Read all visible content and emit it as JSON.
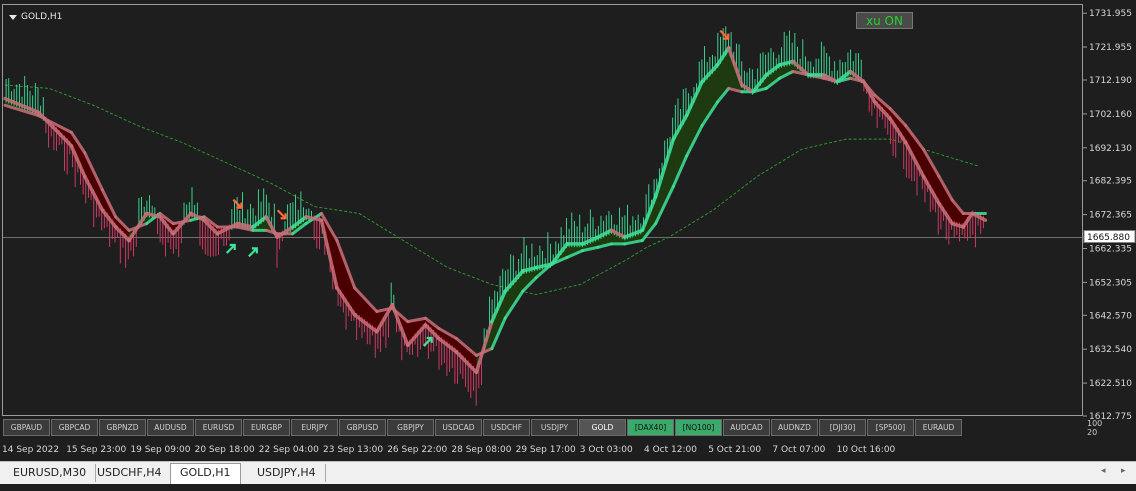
{
  "chart_data": {
    "type": "line",
    "title": "GOLD,H1",
    "symbol": "GOLD",
    "timeframe": "H1",
    "ylim": [
      1612.775,
      1733.5
    ],
    "y_ticks": [
      1731.955,
      1721.955,
      1712.19,
      1702.16,
      1692.13,
      1682.395,
      1672.365,
      1662.335,
      1652.305,
      1642.57,
      1632.54,
      1622.51,
      1612.775
    ],
    "x_ticks": [
      "14 Sep 2022",
      "15 Sep 23:00",
      "19 Sep 09:00",
      "20 Sep 18:00",
      "22 Sep 04:00",
      "23 Sep 13:00",
      "26 Sep 22:00",
      "28 Sep 08:00",
      "29 Sep 17:00",
      "3 Oct 03:00",
      "4 Oct 12:00",
      "5 Oct 21:00",
      "7 Oct 07:00",
      "10 Oct 16:00"
    ],
    "current_price": "1665.880",
    "current_price_value": 1665.88,
    "grid": false,
    "series": [
      {
        "kind": "fast-band",
        "points": [
          [
            0,
            1707
          ],
          [
            1.5,
            1703
          ],
          [
            3,
            1693
          ],
          [
            3.6,
            1684
          ],
          [
            4.4,
            1674
          ],
          [
            5,
            1669
          ],
          [
            5.6,
            1665
          ],
          [
            6.4,
            1673
          ],
          [
            7,
            1672
          ],
          [
            7.6,
            1667
          ],
          [
            8.4,
            1673
          ],
          [
            9,
            1671
          ],
          [
            9.6,
            1667
          ],
          [
            10.5,
            1670
          ],
          [
            11.2,
            1669
          ],
          [
            11.8,
            1672
          ],
          [
            12.3,
            1666
          ],
          [
            13,
            1669
          ],
          [
            13.6,
            1672
          ],
          [
            14.3,
            1671
          ],
          [
            15,
            1651
          ],
          [
            15.8,
            1643
          ],
          [
            16.8,
            1638
          ],
          [
            17.5,
            1646
          ],
          [
            18.2,
            1634
          ],
          [
            19,
            1640
          ],
          [
            19.6,
            1636
          ],
          [
            20.4,
            1632
          ],
          [
            21.3,
            1626
          ],
          [
            22,
            1641
          ],
          [
            22.6,
            1650
          ],
          [
            23.4,
            1656
          ],
          [
            24,
            1657
          ],
          [
            24.7,
            1658
          ],
          [
            25.4,
            1664
          ],
          [
            26.1,
            1664
          ],
          [
            26.8,
            1666
          ],
          [
            27.4,
            1668
          ],
          [
            28,
            1666
          ],
          [
            28.8,
            1668
          ],
          [
            29.4,
            1678
          ],
          [
            30.2,
            1695
          ],
          [
            30.8,
            1702
          ],
          [
            31.5,
            1712
          ],
          [
            32.2,
            1717
          ],
          [
            32.7,
            1722
          ],
          [
            33.3,
            1711
          ],
          [
            33.8,
            1709
          ],
          [
            34.4,
            1714
          ],
          [
            35,
            1717
          ],
          [
            35.6,
            1718
          ],
          [
            36.3,
            1714
          ],
          [
            37,
            1714
          ],
          [
            37.6,
            1712
          ],
          [
            38.2,
            1715
          ],
          [
            38.8,
            1712
          ],
          [
            39.3,
            1706
          ],
          [
            40,
            1701
          ],
          [
            40.7,
            1694
          ],
          [
            41.5,
            1684
          ],
          [
            42.2,
            1676
          ],
          [
            42.8,
            1670
          ],
          [
            43.3,
            1669
          ],
          [
            43.7,
            1673
          ],
          [
            44.3,
            1671
          ]
        ]
      },
      {
        "kind": "slow-band",
        "points": [
          [
            0,
            1705
          ],
          [
            1.5,
            1702
          ],
          [
            3,
            1697
          ],
          [
            3.6,
            1691
          ],
          [
            4.4,
            1680
          ],
          [
            5,
            1672
          ],
          [
            5.6,
            1668
          ],
          [
            6.4,
            1670
          ],
          [
            7,
            1673
          ],
          [
            7.6,
            1670
          ],
          [
            8.4,
            1671
          ],
          [
            9,
            1672
          ],
          [
            9.6,
            1669
          ],
          [
            10.5,
            1669
          ],
          [
            11.2,
            1668
          ],
          [
            11.8,
            1668
          ],
          [
            12.3,
            1667
          ],
          [
            13,
            1667
          ],
          [
            13.6,
            1670
          ],
          [
            14.3,
            1673
          ],
          [
            15,
            1665
          ],
          [
            15.8,
            1651
          ],
          [
            16.8,
            1644
          ],
          [
            17.5,
            1645
          ],
          [
            18.2,
            1641
          ],
          [
            19,
            1642
          ],
          [
            19.6,
            1639
          ],
          [
            20.4,
            1636
          ],
          [
            21.3,
            1631
          ],
          [
            22,
            1633
          ],
          [
            22.6,
            1642
          ],
          [
            23.4,
            1650
          ],
          [
            24,
            1654
          ],
          [
            24.7,
            1658
          ],
          [
            25.4,
            1660
          ],
          [
            26.1,
            1662
          ],
          [
            26.8,
            1663
          ],
          [
            27.4,
            1664
          ],
          [
            28,
            1664
          ],
          [
            28.8,
            1665
          ],
          [
            29.4,
            1670
          ],
          [
            30.2,
            1681
          ],
          [
            30.8,
            1690
          ],
          [
            31.5,
            1699
          ],
          [
            32.2,
            1706
          ],
          [
            32.7,
            1710
          ],
          [
            33.3,
            1709
          ],
          [
            33.8,
            1709
          ],
          [
            34.4,
            1710
          ],
          [
            35,
            1713
          ],
          [
            35.6,
            1715
          ],
          [
            36.3,
            1714
          ],
          [
            37,
            1713
          ],
          [
            37.6,
            1712
          ],
          [
            38.2,
            1713
          ],
          [
            38.8,
            1712
          ],
          [
            39.3,
            1708
          ],
          [
            40,
            1704
          ],
          [
            40.7,
            1699
          ],
          [
            41.5,
            1692
          ],
          [
            42.2,
            1684
          ],
          [
            42.8,
            1677
          ],
          [
            43.3,
            1673
          ],
          [
            43.7,
            1673
          ],
          [
            44.3,
            1673
          ]
        ]
      },
      {
        "kind": "long-ma",
        "points": [
          [
            0,
            1711
          ],
          [
            2,
            1710
          ],
          [
            4,
            1705
          ],
          [
            6,
            1699
          ],
          [
            8,
            1694
          ],
          [
            10,
            1688
          ],
          [
            12,
            1682
          ],
          [
            14,
            1675
          ],
          [
            16,
            1673
          ],
          [
            18,
            1665
          ],
          [
            20,
            1657
          ],
          [
            22,
            1652
          ],
          [
            24,
            1649
          ],
          [
            26,
            1652
          ],
          [
            28,
            1659
          ],
          [
            29,
            1663
          ],
          [
            30,
            1666
          ],
          [
            32,
            1674
          ],
          [
            34,
            1684
          ],
          [
            36,
            1692
          ],
          [
            38,
            1695
          ],
          [
            40,
            1695
          ],
          [
            42,
            1691
          ],
          [
            44,
            1687
          ]
        ]
      }
    ],
    "signals": [
      {
        "x": 10.2,
        "type": "buy"
      },
      {
        "x": 10.5,
        "type": "sell"
      },
      {
        "x": 11.2,
        "type": "buy"
      },
      {
        "x": 12.5,
        "type": "sell"
      },
      {
        "x": 19.1,
        "type": "buy"
      },
      {
        "x": 32.5,
        "type": "sell"
      }
    ]
  },
  "xu_button": {
    "label": "xu ON"
  },
  "symbol_buttons": [
    {
      "label": "GBPAUD",
      "style": "normal"
    },
    {
      "label": "GBPCAD",
      "style": "normal"
    },
    {
      "label": "GBPNZD",
      "style": "normal"
    },
    {
      "label": "AUDUSD",
      "style": "normal"
    },
    {
      "label": "EURUSD",
      "style": "normal"
    },
    {
      "label": "EURGBP",
      "style": "normal"
    },
    {
      "label": "EURJPY",
      "style": "normal"
    },
    {
      "label": "GBPUSD",
      "style": "normal"
    },
    {
      "label": "GBPJPY",
      "style": "normal"
    },
    {
      "label": "USDCAD",
      "style": "normal"
    },
    {
      "label": "USDCHF",
      "style": "normal"
    },
    {
      "label": "USDJPY",
      "style": "normal"
    },
    {
      "label": "GOLD",
      "style": "active"
    },
    {
      "label": "[DAX40]",
      "style": "green"
    },
    {
      "label": "[NQ100]",
      "style": "green"
    },
    {
      "label": "AUDCAD",
      "style": "normal"
    },
    {
      "label": "AUDNZD",
      "style": "normal"
    },
    {
      "label": "[DJI30]",
      "style": "normal"
    },
    {
      "label": "[SP500]",
      "style": "normal"
    },
    {
      "label": "EURAUD",
      "style": "normal"
    }
  ],
  "indicator_scale": {
    "top": "100",
    "bottom": "20"
  },
  "tabs": [
    {
      "label": "EURUSD,M30",
      "active": false
    },
    {
      "label": "USDCHF,H4",
      "active": false
    },
    {
      "label": "GOLD,H1",
      "active": true
    },
    {
      "label": "USDJPY,H4",
      "active": false
    }
  ],
  "tab_nav": {
    "prev": "◂",
    "next": "▸"
  },
  "colors": {
    "background": "#1e1e1e",
    "bull": "#3ee39a",
    "bear": "#e23a66",
    "bull_fill": "#1e3a10",
    "bear_fill": "#4a0000",
    "band_line": "#c9707a",
    "long_ma": "#2fa02f"
  }
}
